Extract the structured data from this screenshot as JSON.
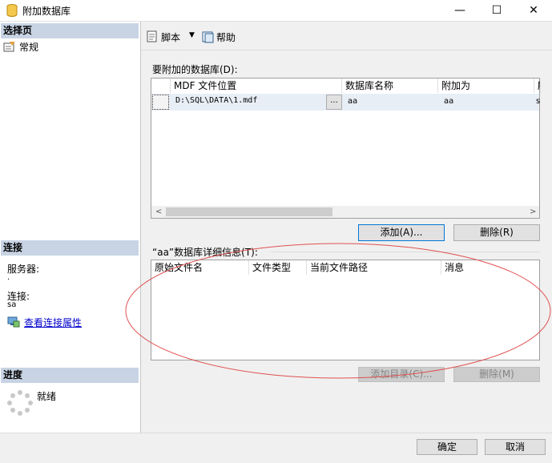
{
  "window": {
    "title": "附加数据库",
    "minimize_glyph": "—",
    "maximize_glyph": "☐",
    "close_glyph": "✕"
  },
  "sidebar": {
    "select_page_header": "选择页",
    "pages": [
      {
        "label": "常规",
        "icon": "general-page-icon"
      }
    ],
    "connection_header": "连接",
    "server_label": "服务器:",
    "server_value": ".",
    "connection_label": "连接:",
    "connection_value": "sa",
    "view_connection_link": "查看连接属性",
    "progress_header": "进度",
    "progress_status": "就绪"
  },
  "toolbar": {
    "script_label": "脚本",
    "help_label": "帮助"
  },
  "attach_section": {
    "label": "要附加的数据库(D):",
    "columns": [
      "MDF 文件位置",
      "数据库名称",
      "附加为",
      "所"
    ],
    "rows": [
      {
        "mdf_path": "D:\\SQL\\DATA\\1.mdf",
        "browse": "...",
        "db_name": "aa",
        "attach_as": "aa",
        "owner": "s"
      }
    ],
    "add_button": "添加(A)...",
    "remove_button": "删除(R)"
  },
  "details_section": {
    "label": "“aa”数据库详细信息(T):",
    "columns": [
      "原始文件名",
      "文件类型",
      "当前文件路径",
      "消息"
    ],
    "add_catalog_button": "添加目录(C)...",
    "remove_button": "删除(M)"
  },
  "footer": {
    "ok_button": "确定",
    "cancel_button": "取消"
  },
  "colors": {
    "section_header_bg": "#c8d4e4",
    "selected_row_bg": "#e8eef6",
    "annotation_ellipse": "#e05050",
    "primary_button_border": "#0078d7"
  }
}
